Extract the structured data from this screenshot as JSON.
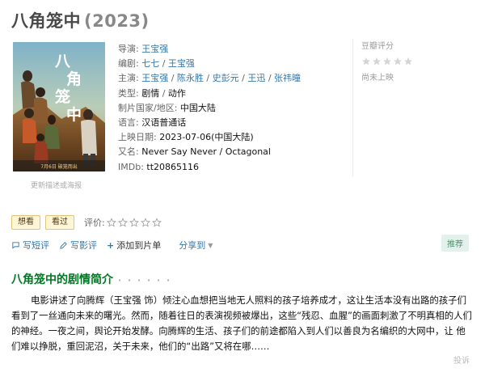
{
  "movie": {
    "title": "八角笼中",
    "year": "(2023)"
  },
  "poster": {
    "alt_text": "八角笼中 poster",
    "caption_link": "更新描述或海报",
    "poster_title_chars": "八角笼中",
    "poster_date_line": "7月6日 破笼而出"
  },
  "info": {
    "director_label": "导演:",
    "director": "王宝强",
    "writer_label": "编剧:",
    "writers": [
      "七七",
      "王宝强"
    ],
    "cast_label": "主演:",
    "cast": [
      "王宝强",
      "陈永胜",
      "史彭元",
      "王迅",
      "张祎曈"
    ],
    "genre_label": "类型:",
    "genres": [
      "剧情",
      "动作"
    ],
    "country_label": "制片国家/地区:",
    "country": "中国大陆",
    "language_label": "语言:",
    "language": "汉语普通话",
    "release_label": "上映日期:",
    "release_date": "2023-07-06(中国大陆)",
    "aka_label": "又名:",
    "aka": "Never Say Never / Octagonal",
    "imdb_label": "IMDb:",
    "imdb": "tt20865116",
    "separator": " / "
  },
  "rating": {
    "title": "豆瓣评分",
    "stars_filled": 0,
    "stars_total": 5,
    "status": "尚未上映"
  },
  "actions": {
    "want_to_see": "想看",
    "seen": "看过",
    "evaluate_label": "评价:",
    "write_short_review": "写短评",
    "write_review": "写影评",
    "add_to_list": "添加到片单",
    "share_to": "分享到",
    "recommend": "推荐"
  },
  "intro": {
    "title": "八角笼中的剧情简介",
    "dots": "· · · · · ·",
    "text": "电影讲述了向腾辉（王宝强 饰）倾注心血想把当地无人照料的孩子培养成才，这让生活本没有出路的孩子们看到了一丝通向未来的曙光。然而，随着往日的表演视频被爆出，这些“残忍、血腥”的画面刺激了不明真相的人们的神经。一夜之间，舆论开始发酵。向腾辉的生活、孩子们的前途都陷入到人们以善良为名编织的大网中，让 他们难以挣脱，重回泥沼，关于未来，他们的“出路”又将在哪……",
    "report": "投诉"
  },
  "colors": {
    "link": "#3377aa",
    "intro_title": "#007722",
    "button_bg": "#fff5d7",
    "recommend_bg": "#e3f1ed",
    "star_empty": "#d4d4d4"
  }
}
